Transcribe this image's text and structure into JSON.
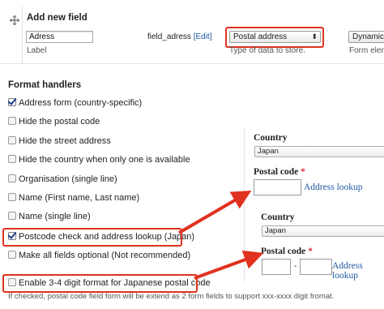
{
  "add_field": {
    "title": "Add new field",
    "label_value": "Adress",
    "label_caption": "Label",
    "machine_name": "field_adress",
    "edit_link": "[Edit]",
    "type_selected": "Postal address",
    "type_help": "Type of data to store.",
    "widget_selected": "Dynamic",
    "widget_help": "Form elem"
  },
  "format_handlers": {
    "title": "Format handlers",
    "options": [
      {
        "label": "Address form (country-specific)",
        "checked": true
      },
      {
        "label": "Hide the postal code",
        "checked": false
      },
      {
        "label": "Hide the street address",
        "checked": false
      },
      {
        "label": "Hide the country when only one is available",
        "checked": false
      },
      {
        "label": "Organisation (single line)",
        "checked": false
      },
      {
        "label": "Name (First name, Last name)",
        "checked": false
      },
      {
        "label": "Name (single line)",
        "checked": false
      },
      {
        "label": "Postcode check and address lookup (Japan)",
        "checked": true
      },
      {
        "label": "Make all fields optional (Not recommended)",
        "checked": false
      },
      {
        "label": "Enable 3-4 digit format for Japanese postal code",
        "checked": false
      }
    ],
    "help": "If checked, postal code field form will be extend as 2 form fields to support xxx-xxxx digit fromat."
  },
  "preview1": {
    "country_label": "Country",
    "country_value": "Japan",
    "postal_label": "Postal code",
    "required_mark": "*",
    "lookup_link": "Address lookup"
  },
  "preview2": {
    "country_label": "Country",
    "country_value": "Japan",
    "postal_label": "Postal code",
    "required_mark": "*",
    "separator": "-",
    "lookup_link": "Address lookup"
  },
  "colors": {
    "highlight": "#e0321f",
    "link": "#1f5aa5",
    "required": "#dd3333"
  },
  "icons": [
    "drag-handle-icon",
    "checkbox-icon",
    "arrow-icon"
  ]
}
